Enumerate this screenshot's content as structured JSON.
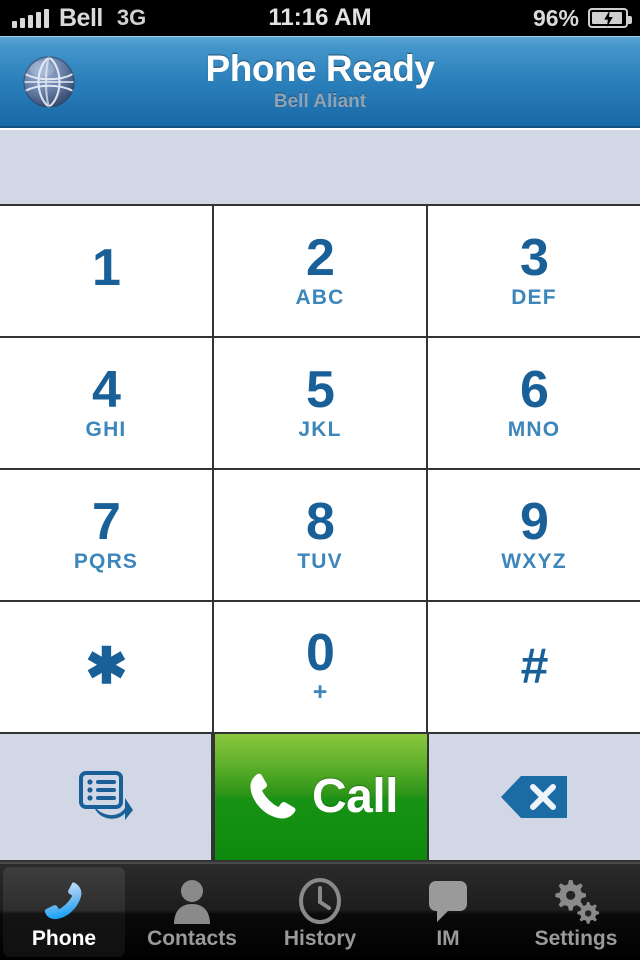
{
  "status_bar": {
    "signal_icon": "signal-bars-icon",
    "signal_bars": 5,
    "carrier": "Bell",
    "network": "3G",
    "time": "11:16 AM",
    "battery_percent": "96%",
    "battery_icon": "battery-charging-icon"
  },
  "header": {
    "logo_icon": "globe-icon",
    "title": "Phone Ready",
    "subtitle": "Bell Aliant",
    "accent_top": "#5ca6d6",
    "accent_bottom": "#1a6aa8"
  },
  "display": {
    "number": "",
    "placeholder": "",
    "background": "#d2d7e6"
  },
  "keypad": {
    "digit_color": "#1a6098",
    "letters_color": "#3d86bb",
    "rows": [
      [
        {
          "digit": "1",
          "letters": ""
        },
        {
          "digit": "2",
          "letters": "ABC"
        },
        {
          "digit": "3",
          "letters": "DEF"
        }
      ],
      [
        {
          "digit": "4",
          "letters": "GHI"
        },
        {
          "digit": "5",
          "letters": "JKL"
        },
        {
          "digit": "6",
          "letters": "MNO"
        }
      ],
      [
        {
          "digit": "7",
          "letters": "PQRS"
        },
        {
          "digit": "8",
          "letters": "TUV"
        },
        {
          "digit": "9",
          "letters": "WXYZ"
        }
      ],
      [
        {
          "digit": "✱",
          "letters": ""
        },
        {
          "digit": "0",
          "letters": "+"
        },
        {
          "digit": "#",
          "letters": ""
        }
      ]
    ]
  },
  "actions": {
    "redial_icon": "call-log-icon",
    "call_label": "Call",
    "call_icon": "handset-icon",
    "call_color_top": "#8cc63f",
    "call_color_bottom": "#0d8a0d",
    "backspace_icon": "backspace-delete-icon"
  },
  "tabbar": {
    "active_index": 0,
    "items": [
      {
        "label": "Phone",
        "icon": "handset-icon"
      },
      {
        "label": "Contacts",
        "icon": "person-icon"
      },
      {
        "label": "History",
        "icon": "clock-icon"
      },
      {
        "label": "IM",
        "icon": "speech-bubble-icon"
      },
      {
        "label": "Settings",
        "icon": "gears-icon"
      }
    ]
  }
}
